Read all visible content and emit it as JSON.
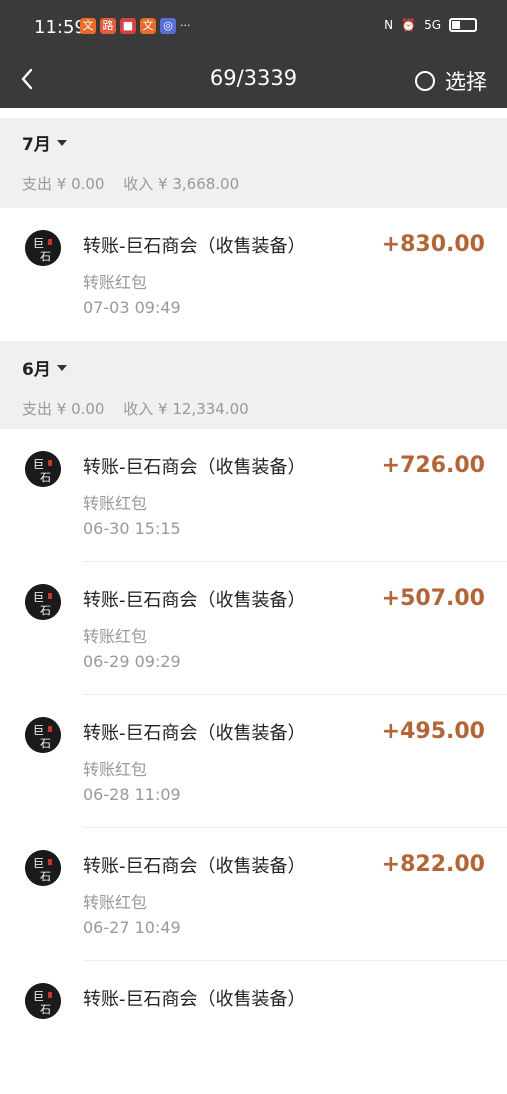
{
  "status_bar": {
    "time": "11:59",
    "network": "5G",
    "battery_level": 0.35
  },
  "nav": {
    "title": "69/3339",
    "select_label": "选择"
  },
  "months": [
    {
      "label": "7月",
      "expense": "支出 ¥ 0.00",
      "income": "收入 ¥ 3,668.00",
      "items": [
        {
          "name": "转账-巨石商会（收售装备）",
          "type": "转账红包",
          "date": "07-03  09:49",
          "amount": "+830.00"
        }
      ]
    },
    {
      "label": "6月",
      "expense": "支出 ¥ 0.00",
      "income": "收入 ¥ 12,334.00",
      "items": [
        {
          "name": "转账-巨石商会（收售装备）",
          "type": "转账红包",
          "date": "06-30  15:15",
          "amount": "+726.00"
        },
        {
          "name": "转账-巨石商会（收售装备）",
          "type": "转账红包",
          "date": "06-29  09:29",
          "amount": "+507.00"
        },
        {
          "name": "转账-巨石商会（收售装备）",
          "type": "转账红包",
          "date": "06-28  11:09",
          "amount": "+495.00"
        },
        {
          "name": "转账-巨石商会（收售装备）",
          "type": "转账红包",
          "date": "06-27  10:49",
          "amount": "+822.00"
        },
        {
          "name": "转账-巨石商会（收售装备）",
          "type": "",
          "date": "",
          "amount": ""
        }
      ]
    }
  ],
  "colors": {
    "header_bg": "#3a3a3a",
    "amount": "#b26537",
    "section_bg": "#f0f0f0"
  },
  "icons": {
    "back": "chevron-left-icon",
    "select": "radio-icon",
    "avatar": "stone-guild-logo"
  }
}
